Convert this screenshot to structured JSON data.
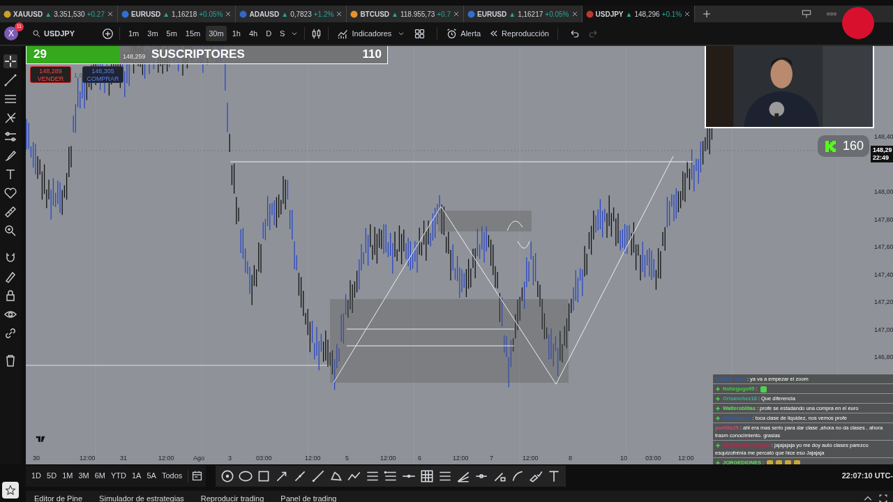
{
  "symbol_tabs": [
    {
      "symbol": "XAUUSD",
      "arrow": "▲",
      "price": "3.351,530",
      "change": "+0.27",
      "selected": false,
      "color": "#c9a227"
    },
    {
      "symbol": "EURUSD",
      "arrow": "▲",
      "price": "1,16218",
      "change": "+0.05%",
      "selected": false,
      "color": "#2f6fd6"
    },
    {
      "symbol": "ADAUSD",
      "arrow": "▲",
      "price": "0,7823",
      "change": "+1.2%",
      "selected": false,
      "color": "#3366cc"
    },
    {
      "symbol": "BTCUSD",
      "arrow": "▲",
      "price": "118.955,73",
      "change": "+0.7",
      "selected": false,
      "color": "#e8912d"
    },
    {
      "symbol": "EURUSD",
      "arrow": "▲",
      "price": "1,16217",
      "change": "+0.05%",
      "selected": false,
      "color": "#2f6fd6"
    },
    {
      "symbol": "USDJPY",
      "arrow": "▲",
      "price": "148,296",
      "change": "+0.1%",
      "selected": true,
      "color": "#c0392b"
    }
  ],
  "toolbar": {
    "avatar": "X",
    "notifications": "11",
    "symbol": "USDJPY",
    "intervals": [
      {
        "label": "1m",
        "selected": false
      },
      {
        "label": "3m",
        "selected": false
      },
      {
        "label": "5m",
        "selected": false
      },
      {
        "label": "15m",
        "selected": false
      },
      {
        "label": "30m",
        "selected": true
      },
      {
        "label": "1h",
        "selected": false
      },
      {
        "label": "4h",
        "selected": false
      },
      {
        "label": "D",
        "selected": false
      },
      {
        "label": "S",
        "selected": false
      }
    ],
    "indicators": "Indicadores",
    "alert": "Alerta",
    "replay": "Reproducción",
    "redo_disabled": true
  },
  "subscriber_goal": {
    "current": "29",
    "label": "SUSCRIPTORES",
    "goal": "110",
    "level": 0.26
  },
  "trade_buttons": [
    {
      "kind": "sell",
      "price": "148,289",
      "label": "VENDER"
    },
    {
      "kind": "buy",
      "price": "148,305",
      "label": "COMPRAR"
    }
  ],
  "chart_labels": {
    "last_price": "148,259",
    "quantity": "1,6",
    "price_tag": "148,29",
    "countdown": "22:49"
  },
  "price_axis": [
    "148,40",
    "148,00",
    "147,80",
    "147,60",
    "147,40",
    "147,20",
    "147,00",
    "146,80"
  ],
  "time_axis": [
    "30",
    "12:00",
    "31",
    "12:00",
    "Ago",
    "3",
    "03:00",
    "12:00",
    "5",
    "12:00",
    "6",
    "12:00",
    "7",
    "12:00",
    "8",
    "10",
    "03:00",
    "12:00"
  ],
  "kick_badge": {
    "count": "160"
  },
  "chat": [
    {
      "user": "Liliana_soto",
      "text": ": ya va a empezar el zoom",
      "color": "#2c5fb8",
      "badge": false
    },
    {
      "user": "Nohegugo95",
      "text": ":",
      "color": "#3fcf3f",
      "badge": true,
      "emotes": [
        {
          "color": "#4fd04f"
        }
      ]
    },
    {
      "user": "Orisanchez18",
      "text": ": Que diferencia",
      "color": "#36b0a0",
      "badge": true
    },
    {
      "user": "Walteroblitas",
      "text": ": profe se estadando una compra en el euro",
      "color": "#5ee05e",
      "badge": true
    },
    {
      "user": "Mariaburga",
      "text": ": toca clase de liquidez, nos vemos profe",
      "color": "#2c5fb8",
      "badge": true
    },
    {
      "user": "portillo25",
      "text": ": ahi era mas serio para dar clase ,ahora no da clases , ahora trasm conocimiento. grasias",
      "color": "#d14a7a",
      "badge": false
    },
    {
      "user": "WolfhunterOriginal",
      "text": ": jajajajaja yo me doy auto clases parezco esquizofrénia me percató que hice eso Jajajaja",
      "color": "#c0264a",
      "badge": true
    },
    {
      "user": "JORGEDIONES",
      "text": ":",
      "color": "#5ee05e",
      "badge": true,
      "emotes": [
        {
          "color": "#c9a93a"
        },
        {
          "color": "#c9a93a"
        },
        {
          "color": "#c9a93a"
        },
        {
          "color": "#c9a93a"
        }
      ]
    }
  ],
  "ranges": [
    "1D",
    "5D",
    "1M",
    "3M",
    "6M",
    "YTD",
    "1A",
    "5A",
    "Todos"
  ],
  "clock": "22:07:10 UTC-",
  "bottom_tabs": [
    "Editor de Pine",
    "Simulador de estrategias",
    "Reproducir trading",
    "Panel de trading"
  ]
}
